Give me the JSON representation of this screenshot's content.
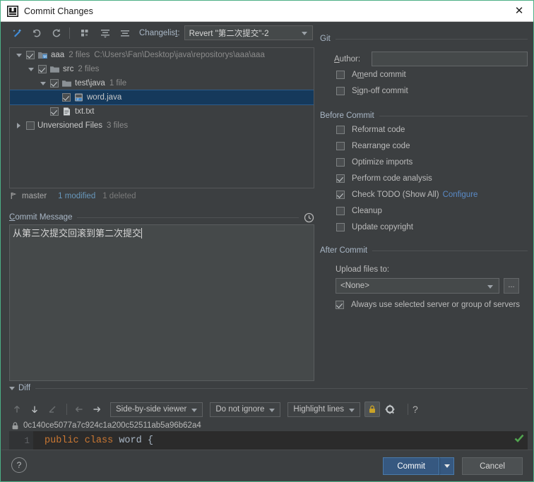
{
  "window": {
    "title": "Commit Changes",
    "app_icon": "intellij-idea-icon",
    "close_label": "✕"
  },
  "toolbar": {
    "buttons": [
      {
        "name": "magic-wand-icon",
        "title": "Magic"
      },
      {
        "name": "rollback-icon",
        "title": "Rollback"
      },
      {
        "name": "refresh-icon",
        "title": "Refresh"
      },
      {
        "name": "group-by-icon",
        "title": "Group By"
      },
      {
        "name": "expand-all-icon",
        "title": "Expand All"
      },
      {
        "name": "collapse-all-icon",
        "title": "Collapse All"
      }
    ],
    "changelist_label": "Changelist:",
    "changelist_label_accesskey": "t",
    "changelist_value": "Revert \"第二次提交\"-2"
  },
  "tree": {
    "rows": [
      {
        "indent": 0,
        "expander": "down",
        "checked": true,
        "icon": "module-icon",
        "name": "aaa",
        "meta": "2 files",
        "path": "C:\\Users\\Fan\\Desktop\\java\\repositorys\\aaa\\aaa",
        "selected": false
      },
      {
        "indent": 1,
        "expander": "down",
        "checked": true,
        "icon": "folder-icon",
        "name": "src",
        "meta": "2 files",
        "path": "",
        "selected": false
      },
      {
        "indent": 2,
        "expander": "down",
        "checked": true,
        "icon": "folder-icon",
        "name": "test\\java",
        "meta": "1 file",
        "path": "",
        "selected": false
      },
      {
        "indent": 3,
        "expander": "none",
        "checked": true,
        "icon": "java-file-icon",
        "name": "word.java",
        "meta": "",
        "path": "",
        "selected": true
      },
      {
        "indent": 2,
        "expander": "none",
        "checked": true,
        "icon": "text-file-icon",
        "name": "txt.txt",
        "meta": "",
        "path": "",
        "selected": false
      },
      {
        "indent": 0,
        "expander": "right",
        "checked": false,
        "icon": "none",
        "name": "Unversioned Files",
        "meta": "3 files",
        "path": "",
        "selected": false
      }
    ]
  },
  "status": {
    "branch_icon": "git-branch-icon",
    "branch": "master",
    "modified": "1 modified",
    "deleted": "1 deleted",
    "modified_color": "#6897bb",
    "deleted_color": "#7a7a7a"
  },
  "commit_message": {
    "label": "Commit Message",
    "label_accesskey": "C",
    "history_icon": "clock-icon",
    "value": "从第三次提交回滚到第二次提交"
  },
  "git_section": {
    "title": "Git",
    "author_label": "Author:",
    "author_accesskey": "A",
    "author_value": "",
    "checkboxes": [
      {
        "label": "Amend commit",
        "checked": false,
        "name": "amend-commit"
      },
      {
        "label": "Sign-off commit",
        "checked": false,
        "name": "sign-off-commit"
      }
    ]
  },
  "before_commit": {
    "title": "Before Commit",
    "checkboxes": [
      {
        "label": "Reformat code",
        "checked": false,
        "name": "reformat-code",
        "link": ""
      },
      {
        "label": "Rearrange code",
        "checked": false,
        "name": "rearrange-code",
        "link": ""
      },
      {
        "label": "Optimize imports",
        "checked": false,
        "name": "optimize-imports",
        "link": ""
      },
      {
        "label": "Perform code analysis",
        "checked": true,
        "name": "perform-code-analysis",
        "link": ""
      },
      {
        "label": "Check TODO (Show All)",
        "checked": true,
        "name": "check-todo",
        "link": "Configure"
      },
      {
        "label": "Cleanup",
        "checked": false,
        "name": "cleanup",
        "link": ""
      },
      {
        "label": "Update copyright",
        "checked": false,
        "name": "update-copyright",
        "link": ""
      }
    ]
  },
  "after_commit": {
    "title": "After Commit",
    "upload_label": "Upload files to:",
    "upload_value": "<None>",
    "browse_label": "...",
    "always_use_label": "Always use selected server or group of servers",
    "always_use_checked": true
  },
  "diff": {
    "title": "Diff",
    "buttons": [
      {
        "name": "prev-difference-icon",
        "state": "disabled"
      },
      {
        "name": "next-difference-icon",
        "state": "enabled"
      },
      {
        "name": "compare-icon",
        "state": "disabled"
      },
      {
        "name": "previous-file-icon",
        "state": "disabled"
      },
      {
        "name": "next-file-icon",
        "state": "enabled"
      }
    ],
    "viewer_mode": "Side-by-side viewer",
    "ignore_mode": "Do not ignore",
    "highlight_mode": "Highlight lines",
    "lock_icon": "lock-icon",
    "settings_icon": "gear-icon",
    "help_label": "?",
    "revision_hash": "0c140ce5077a7c924c1a200c52511ab5a96b62a4",
    "revision_lock_icon": "lock-icon",
    "line_number": "1",
    "code_keyword": "public class",
    "code_rest": " word {",
    "keyword_color": "#cc7832",
    "text_color": "#a9b7c6",
    "inspection_icon": "green-check-icon"
  },
  "footer": {
    "help_label": "?",
    "commit_label": "Commit",
    "cancel_label": "Cancel",
    "commit_color": "#365880"
  }
}
